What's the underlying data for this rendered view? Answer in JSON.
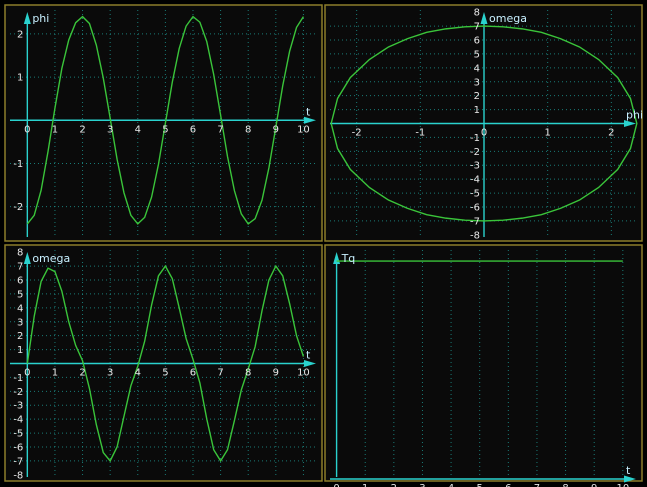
{
  "colors": {
    "background": "#000000",
    "panel": "#0a0a0a",
    "border": "#8c7d2a",
    "axis": "#2ad2ce",
    "curve": "#3ac43a",
    "label": "#e8e8e8"
  },
  "chart_data": [
    {
      "type": "line",
      "xlabel": "t",
      "ylabel": "phi",
      "xlim": [
        -0.7,
        10.6
      ],
      "ylim": [
        -2.75,
        2.6
      ],
      "xticks": [
        "0",
        "1",
        "2",
        "3",
        "4",
        "5",
        "6",
        "7",
        "8",
        "9",
        "10"
      ],
      "xtick_values": [
        0,
        1,
        2,
        3,
        4,
        5,
        6,
        7,
        8,
        9,
        10
      ],
      "yticks": [
        "2",
        "1",
        "0",
        "-1",
        "-2"
      ],
      "ytick_values": [
        2,
        1,
        0,
        -1,
        -2
      ],
      "xgrid": [
        1,
        2,
        3,
        4,
        5,
        6,
        7,
        8,
        9,
        10
      ],
      "ygrid": [
        -2,
        -1,
        1,
        2
      ],
      "grid": true,
      "series": [
        {
          "x": [
            0,
            0.25,
            0.5,
            0.75,
            1,
            1.25,
            1.5,
            1.75,
            2,
            2.25,
            2.5,
            2.75,
            3,
            3.25,
            3.5,
            3.75,
            4,
            4.25,
            4.5,
            4.75,
            5,
            5.25,
            5.5,
            5.75,
            6,
            6.25,
            6.5,
            6.75,
            7,
            7.25,
            7.5,
            7.75,
            8,
            8.25,
            8.5,
            8.75,
            9,
            9.25,
            9.5,
            9.75,
            10
          ],
          "y": [
            -2.4,
            -2.2,
            -1.62,
            -0.72,
            0.28,
            1.2,
            1.86,
            2.26,
            2.4,
            2.24,
            1.74,
            0.98,
            0.05,
            -0.9,
            -1.68,
            -2.2,
            -2.4,
            -2.25,
            -1.78,
            -1.02,
            -0.07,
            0.88,
            1.66,
            2.18,
            2.4,
            2.27,
            1.82,
            1.06,
            0.12,
            -0.84,
            -1.63,
            -2.17,
            -2.4,
            -2.28,
            -1.85,
            -1.1,
            -0.16,
            0.8,
            1.6,
            2.15,
            2.4
          ]
        }
      ]
    },
    {
      "type": "line",
      "xlabel": "phi",
      "ylabel": "omega",
      "xlim": [
        -2.45,
        2.45
      ],
      "ylim": [
        -8.3,
        8.3
      ],
      "xticks": [
        "-2",
        "-1",
        "0",
        "1",
        "2"
      ],
      "xtick_values": [
        -2,
        -1,
        0,
        1,
        2
      ],
      "yticks": [
        "8",
        "7",
        "6",
        "5",
        "4",
        "3",
        "2",
        "1",
        "0",
        "-1",
        "-2",
        "-3",
        "-4",
        "-5",
        "-6",
        "-7",
        "-8"
      ],
      "ytick_values": [
        8,
        7,
        6,
        5,
        4,
        3,
        2,
        1,
        0,
        -1,
        -2,
        -3,
        -4,
        -5,
        -6,
        -7,
        -8
      ],
      "xgrid": [
        -2,
        -1,
        1,
        2
      ],
      "ygrid": [
        -7,
        -6,
        -5,
        -4,
        -3,
        -2,
        -1,
        1,
        2,
        3,
        4,
        5,
        6,
        7
      ],
      "grid": true,
      "series": [
        {
          "x": [
            -2.4,
            -2.3,
            -2.1,
            -1.8,
            -1.5,
            -1.2,
            -0.9,
            -0.6,
            -0.3,
            0,
            0.3,
            0.6,
            0.9,
            1.2,
            1.5,
            1.8,
            2.1,
            2.3,
            2.4,
            2.3,
            2.1,
            1.8,
            1.5,
            1.2,
            0.9,
            0.6,
            0.3,
            0,
            -0.3,
            -0.6,
            -0.9,
            -1.2,
            -1.5,
            -1.8,
            -2.1,
            -2.3,
            -2.4
          ],
          "y": [
            0,
            1.8,
            3.3,
            4.6,
            5.5,
            6.1,
            6.55,
            6.8,
            6.95,
            7,
            6.95,
            6.8,
            6.55,
            6.1,
            5.5,
            4.6,
            3.3,
            1.8,
            0,
            -1.8,
            -3.3,
            -4.6,
            -5.5,
            -6.1,
            -6.55,
            -6.8,
            -6.95,
            -7,
            -6.95,
            -6.8,
            -6.55,
            -6.1,
            -5.5,
            -4.6,
            -3.3,
            -1.8,
            0
          ]
        }
      ]
    },
    {
      "type": "line",
      "xlabel": "t",
      "ylabel": "omega",
      "xlim": [
        -0.7,
        10.6
      ],
      "ylim": [
        -8.3,
        8.3
      ],
      "xticks": [
        "0",
        "1",
        "2",
        "3",
        "4",
        "5",
        "6",
        "7",
        "8",
        "9",
        "10"
      ],
      "xtick_values": [
        0,
        1,
        2,
        3,
        4,
        5,
        6,
        7,
        8,
        9,
        10
      ],
      "yticks": [
        "8",
        "7",
        "6",
        "5",
        "4",
        "3",
        "2",
        "1",
        "0",
        "-1",
        "-2",
        "-3",
        "-4",
        "-5",
        "-6",
        "-7",
        "-8"
      ],
      "ytick_values": [
        8,
        7,
        6,
        5,
        4,
        3,
        2,
        1,
        0,
        -1,
        -2,
        -3,
        -4,
        -5,
        -6,
        -7,
        -8
      ],
      "xgrid": [
        1,
        2,
        3,
        4,
        5,
        6,
        7,
        8,
        9,
        10
      ],
      "ygrid": [
        -7,
        -6,
        -5,
        -4,
        -3,
        -2,
        -1,
        1,
        2,
        3,
        4,
        5,
        6,
        7
      ],
      "grid": true,
      "series": [
        {
          "x": [
            0,
            0.25,
            0.5,
            0.75,
            1,
            1.25,
            1.5,
            1.75,
            2,
            2.25,
            2.5,
            2.75,
            3,
            3.25,
            3.5,
            3.75,
            4,
            4.25,
            4.5,
            4.75,
            5,
            5.25,
            5.5,
            5.75,
            6,
            6.25,
            6.5,
            6.75,
            7,
            7.25,
            7.5,
            7.75,
            8,
            8.25,
            8.5,
            8.75,
            9,
            9.25,
            9.5,
            9.75,
            10
          ],
          "y": [
            0,
            3.4,
            5.9,
            6.85,
            6.6,
            5.2,
            3.0,
            1.3,
            0.2,
            -1.8,
            -4.4,
            -6.4,
            -7.0,
            -6.0,
            -3.8,
            -1.6,
            -0.2,
            1.6,
            4.2,
            6.3,
            7.0,
            6.1,
            4.0,
            1.8,
            0.3,
            -1.4,
            -4.0,
            -6.2,
            -7.0,
            -6.2,
            -4.1,
            -1.9,
            -0.4,
            1.2,
            3.8,
            6.0,
            7.0,
            6.3,
            4.3,
            2.0,
            0.5
          ]
        }
      ]
    },
    {
      "type": "line",
      "xlabel": "t",
      "ylabel": "Tq",
      "xlim": [
        -0.3,
        10.6
      ],
      "ylim": [
        0,
        1.06
      ],
      "xticks": [
        "0",
        "1",
        "2",
        "3",
        "4",
        "5",
        "6",
        "7",
        "8",
        "9",
        "10"
      ],
      "xtick_values": [
        0,
        1,
        2,
        3,
        4,
        5,
        6,
        7,
        8,
        9,
        10
      ],
      "yticks": [],
      "ytick_values": [],
      "xgrid": [
        1,
        2,
        3,
        4,
        5,
        6,
        7,
        8,
        9,
        10
      ],
      "ygrid": [],
      "grid": true,
      "series": [
        {
          "x": [
            0,
            10
          ],
          "y": [
            1,
            1
          ]
        }
      ]
    }
  ]
}
